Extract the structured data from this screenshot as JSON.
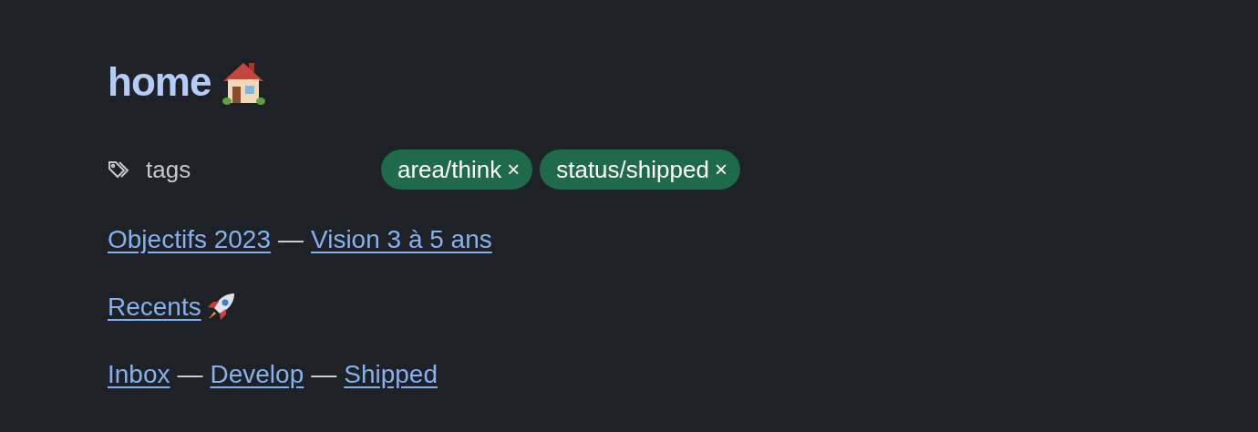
{
  "title": "home",
  "properties": [
    {
      "label": "tags",
      "tags": [
        {
          "label": "area/think",
          "remove": "×"
        },
        {
          "label": "status/shipped",
          "remove": "×"
        }
      ]
    }
  ],
  "link_lines": [
    {
      "parts": [
        {
          "kind": "link",
          "text": "Objectifs 2023"
        },
        {
          "kind": "separator",
          "text": "—"
        },
        {
          "kind": "link",
          "text": "Vision 3 à 5 ans"
        }
      ]
    },
    {
      "parts": [
        {
          "kind": "link-icon",
          "text": "Recents"
        }
      ]
    },
    {
      "parts": [
        {
          "kind": "link",
          "text": "Inbox"
        },
        {
          "kind": "separator",
          "text": "—"
        },
        {
          "kind": "link",
          "text": "Develop"
        },
        {
          "kind": "separator",
          "text": "—"
        },
        {
          "kind": "link",
          "text": "Shipped"
        }
      ]
    }
  ]
}
